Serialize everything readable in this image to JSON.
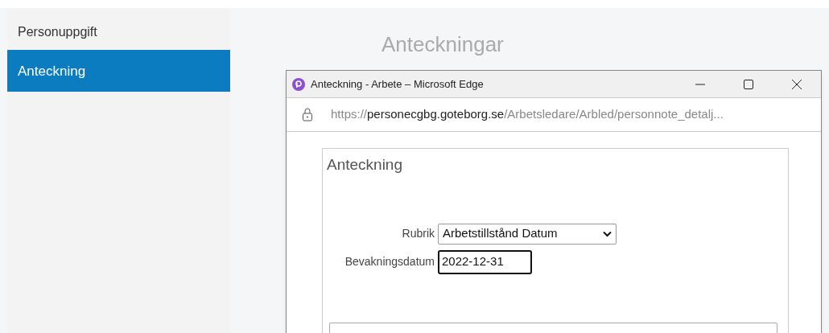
{
  "sidebar": {
    "items": [
      {
        "label": "Personuppgift",
        "selected": false
      },
      {
        "label": "Anteckning",
        "selected": true
      }
    ]
  },
  "page": {
    "heading": "Anteckningar"
  },
  "popup": {
    "title": "Anteckning - Arbete – Microsoft Edge",
    "url_scheme": "https://",
    "url_host": "personecgbg.goteborg.se",
    "url_path": "/Arbetsledare/Arbled/personnote_detalj...",
    "form": {
      "title": "Anteckning",
      "rubrik": {
        "label": "Rubrik",
        "value": "Arbetstillstånd Datum"
      },
      "bevakningsdatum": {
        "label": "Bevakningsdatum",
        "value": "2022-12-31",
        "focused": true
      }
    }
  }
}
